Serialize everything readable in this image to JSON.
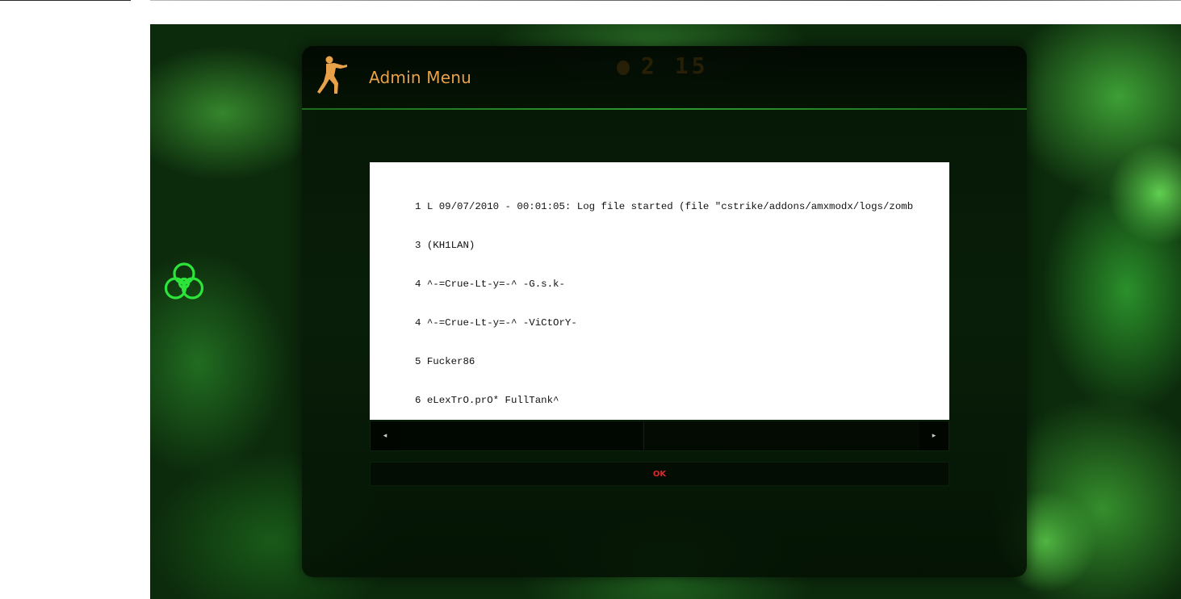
{
  "dialog": {
    "title": "Admin Menu",
    "ok_label": "OK"
  },
  "hud": {
    "timer": "2 15"
  },
  "log": {
    "lines": [
      "1 L 09/07/2010 - 00:01:05: Log file started (file \"cstrike/addons/amxmodx/logs/zomb",
      "3 (KH1LAN)",
      "4 ^-=Crue-Lt-y=-^ -G.s.k-",
      "4 ^-=Crue-Lt-y=-^ -ViCtOrY-",
      "5 Fucker86",
      "6 eLexTrO.prO* FullTank^"
    ]
  },
  "scrollbar": {
    "left_arrow": "◂",
    "right_arrow": "▸"
  },
  "icons": {
    "logo": "counter-strike-logo-icon",
    "hazard": "biohazard-icon"
  },
  "colors": {
    "title": "#e9a24a",
    "ok_text": "#e3262a",
    "hazard": "#2de53a"
  }
}
